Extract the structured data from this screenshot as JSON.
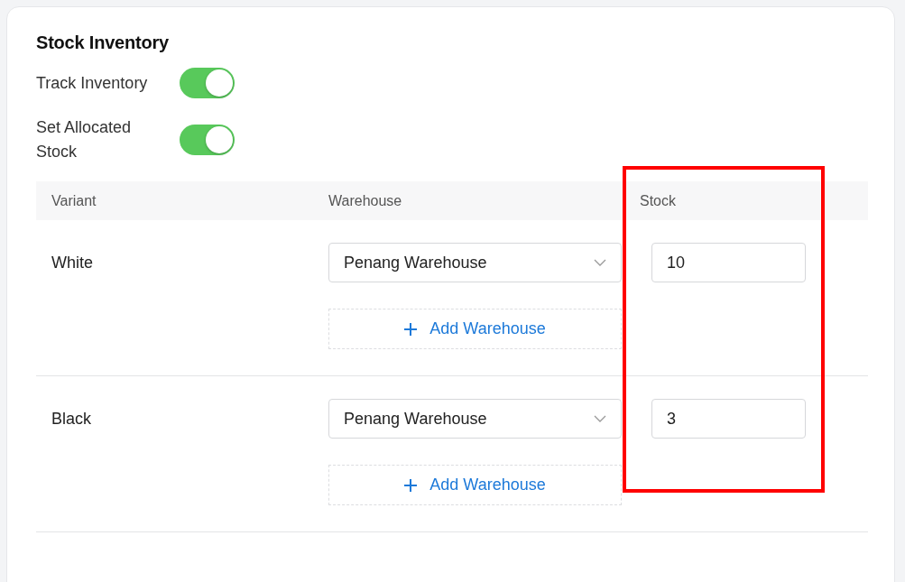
{
  "title": "Stock Inventory",
  "settings": [
    {
      "label": "Track Inventory",
      "on": true
    },
    {
      "label": "Set Allocated Stock",
      "on": true
    }
  ],
  "table": {
    "columns": [
      "Variant",
      "Warehouse",
      "Stock"
    ],
    "rows": [
      {
        "variant": "White",
        "warehouse": "Penang Warehouse",
        "stock": "10",
        "add_label": "Add Warehouse"
      },
      {
        "variant": "Black",
        "warehouse": "Penang Warehouse",
        "stock": "3",
        "add_label": "Add Warehouse"
      }
    ]
  }
}
